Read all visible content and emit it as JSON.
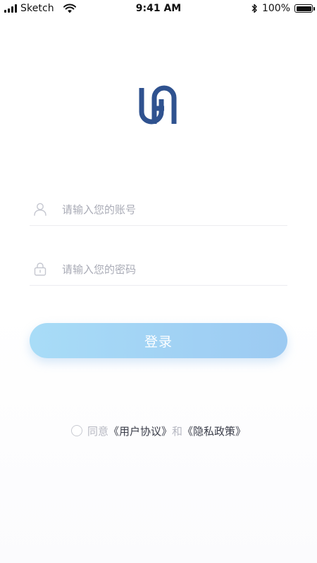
{
  "status_bar": {
    "carrier": "Sketch",
    "time": "9:41 AM",
    "battery_percent": "100%",
    "battery_level": 1.0,
    "icons": [
      "signal-icon",
      "wifi-icon",
      "bluetooth-icon",
      "battery-icon"
    ]
  },
  "logo": {
    "icon": "brand-logo",
    "color": "#2f528f"
  },
  "form": {
    "account": {
      "icon": "user-icon",
      "placeholder": "请输入您的账号",
      "value": ""
    },
    "password": {
      "icon": "lock-icon",
      "placeholder": "请输入您的密码",
      "value": ""
    },
    "login_button": "登录"
  },
  "agreement": {
    "checked": false,
    "agree_text": "同意",
    "user_agreement": "《用户协议》",
    "and_text": "和",
    "privacy_policy": "《隐私政策》"
  },
  "colors": {
    "accent_start": "#a8dcf7",
    "accent_end": "#9ccaf2",
    "placeholder": "#a9abb6",
    "muted_text": "#b6b8c2",
    "link_text": "#3a3d49"
  }
}
